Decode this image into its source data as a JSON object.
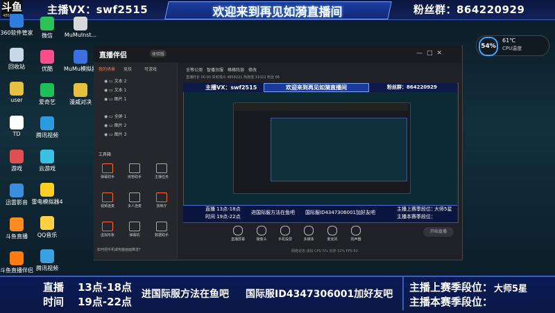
{
  "top_bar": {
    "logo": "斗鱼",
    "logo_sub": "4858221V",
    "host_label": "主播VX：swf2515",
    "welcome": "欢迎来到再见如漪直播间",
    "fans_label": "粉丝群：864220929"
  },
  "desktop_icons_left": [
    {
      "label": "360软件管家",
      "color": "#2d7de0"
    },
    {
      "label": "回收站",
      "color": "#c8d8e8"
    },
    {
      "label": "user",
      "color": "#e8c040"
    },
    {
      "label": "TD",
      "color": "#ffffff"
    },
    {
      "label": "游戏",
      "color": "#e05050"
    },
    {
      "label": "迅雷影音",
      "color": "#3a8ee0"
    },
    {
      "label": "斗鱼直播",
      "color": "#ff8a20"
    },
    {
      "label": "斗鱼直播伴侣",
      "color": "#ff7a10"
    }
  ],
  "desktop_icons_mid": [
    {
      "label": "微信",
      "color": "#2dc15a"
    },
    {
      "label": "优酷",
      "color": "#ff4f8a"
    },
    {
      "label": "爱奇艺",
      "color": "#1fc05a"
    },
    {
      "label": "腾讯视频",
      "color": "#2d9ae0"
    },
    {
      "label": "云游戏",
      "color": "#3ac0e0"
    },
    {
      "label": "雷电模拟器4",
      "color": "#ffd020"
    },
    {
      "label": "QQ音乐",
      "color": "#ffd040"
    },
    {
      "label": "腾讯视频",
      "color": "#3aa0e0"
    }
  ],
  "desktop_icons_right": [
    {
      "label": "MuMuInst...",
      "color": "#d8d8d8"
    },
    {
      "label": "MuMu模拟器",
      "color": "#3a70e0"
    },
    {
      "label": "漫威对决",
      "color": "#e8c040"
    }
  ],
  "perf": {
    "pct": "54%",
    "temp": "61℃",
    "label": "CPU温度"
  },
  "window": {
    "title": "直播伴侣",
    "version": "体验版",
    "left_tabs": [
      "我的场景",
      "竞技",
      "可游戏"
    ],
    "layers": [
      "文本 2",
      "文本 1",
      "图片 1",
      "全屏 1",
      "图片 2",
      "图片 3"
    ],
    "tools_title": "工具箱",
    "tools": [
      [
        "弹幕助手",
        "房管助手",
        "主播任务"
      ],
      [
        "视频连麦",
        "多人连麦",
        "放映厅"
      ],
      [
        "虚拟形象",
        "弹幕机",
        "数据助手"
      ]
    ],
    "hint": "如何把手机或电脑画面推送？",
    "right_tabs": [
      "全等公测",
      "智播台服",
      "格格阵容",
      "修改"
    ],
    "stats": "直播时长 00:00   实时观众 4858221   热度值 31022   粉丝 66",
    "bottom_tools": [
      "直播屏幕",
      "摄像头",
      "手机投屏",
      "多媒体",
      "麦克风",
      "扬声器"
    ],
    "go_live": "开始直播",
    "status_line": "网络状态 良好  CPU 5%  内存 32%  FPS 60"
  },
  "preview": {
    "host": "主播VX：swf2515",
    "welcome": "欢迎来到再见如漪直播间",
    "fans": "粉丝群：864220929",
    "schedule": [
      "直播  13点-18点",
      "时间  19点-22点"
    ],
    "msg1": "进国际服方法在鱼吧",
    "msg2": "国际服ID4347306001加好友吧",
    "rank1": "主播上赛季段位：",
    "rank1_val": "大师5星",
    "rank2": "主播本赛季段位："
  },
  "info_bar": {
    "live_label": "直播",
    "time_label": "时间",
    "slot1": "13点-18点",
    "slot2": "19点-22点",
    "msg1": "进国际服方法在鱼吧",
    "msg2": "国际服ID4347306001加好友吧",
    "rank_last": "主播上赛季段位：",
    "rank_last_val": "大师5星",
    "rank_now": "主播本赛季段位："
  }
}
